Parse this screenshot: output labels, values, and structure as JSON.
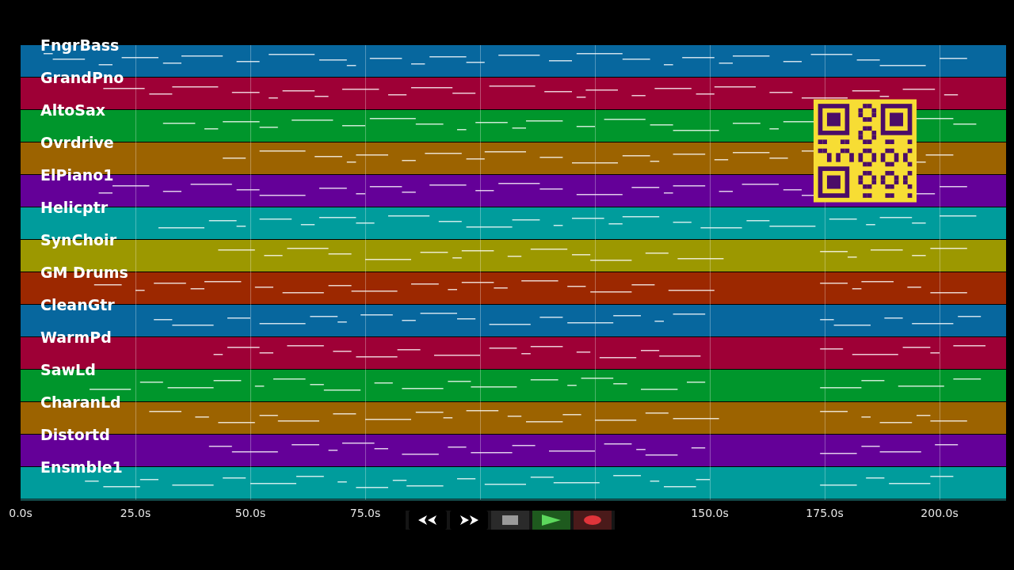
{
  "tracks": [
    {
      "name": "FngrBass",
      "color": "#07679e"
    },
    {
      "name": "GrandPno",
      "color": "#9e0036"
    },
    {
      "name": "AltoSax",
      "color": "#00962c"
    },
    {
      "name": "Ovrdrive",
      "color": "#9c6300"
    },
    {
      "name": "ElPiano1",
      "color": "#640098"
    },
    {
      "name": "Helicptr",
      "color": "#009c9c"
    },
    {
      "name": "SynChoir",
      "color": "#9c9800"
    },
    {
      "name": "GM Drums",
      "color": "#9c2800"
    },
    {
      "name": "CleanGtr",
      "color": "#07679e"
    },
    {
      "name": "WarmPd",
      "color": "#9e0036"
    },
    {
      "name": "SawLd",
      "color": "#00962c"
    },
    {
      "name": "CharanLd",
      "color": "#9c6300"
    },
    {
      "name": "Distortd",
      "color": "#640098"
    },
    {
      "name": "Ensmble1",
      "color": "#009c9c"
    }
  ],
  "time_labels": [
    "0.0s",
    "25.0s",
    "50.0s",
    "75.0s",
    "150.0s",
    "175.0s",
    "200.0s"
  ],
  "transport": [
    {
      "kind": "rewind"
    },
    {
      "kind": "fast-forward"
    },
    {
      "kind": "stop"
    },
    {
      "kind": "play"
    },
    {
      "kind": "record"
    }
  ]
}
